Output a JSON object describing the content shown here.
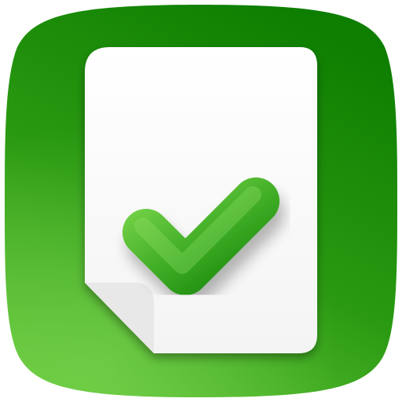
{
  "icon": {
    "name": "document-check-app-icon",
    "symbol": "checkmark-icon",
    "document": "document-page-icon"
  },
  "colors": {
    "background_top": "#0f8200",
    "background_bottom": "#5ec234",
    "page": "#ffffff",
    "page_shadow": "#dcdcdc",
    "check_light": "#6ccc43",
    "check_dark": "#1f8f10"
  }
}
